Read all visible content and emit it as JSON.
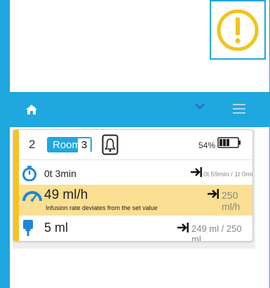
{
  "navbar": {
    "home_icon": "home-icon",
    "chevron_icon": "chevron-down-icon",
    "menu_icon": "menu-icon"
  },
  "warning": {
    "icon": "warning-exclamation-icon",
    "color": "#f2c31c"
  },
  "pump_card": {
    "bed_number": "2",
    "room_label": "Room 2",
    "room_number": "3",
    "battery_percent": "54%",
    "battery_level": 0.54,
    "status_color": "#f6c325",
    "time": {
      "elapsed": "0t 3min",
      "target": "0t 59min / 1t 0min"
    },
    "rate": {
      "value": "49 ml/h",
      "target": "250 ml/h",
      "message": "Infusion rate deviates from the set value",
      "highlight_color": "#fbdf93"
    },
    "volume": {
      "value": "5 ml",
      "target": "249 ml  /  250 ml"
    }
  },
  "colors": {
    "accent": "#1fa7df"
  }
}
